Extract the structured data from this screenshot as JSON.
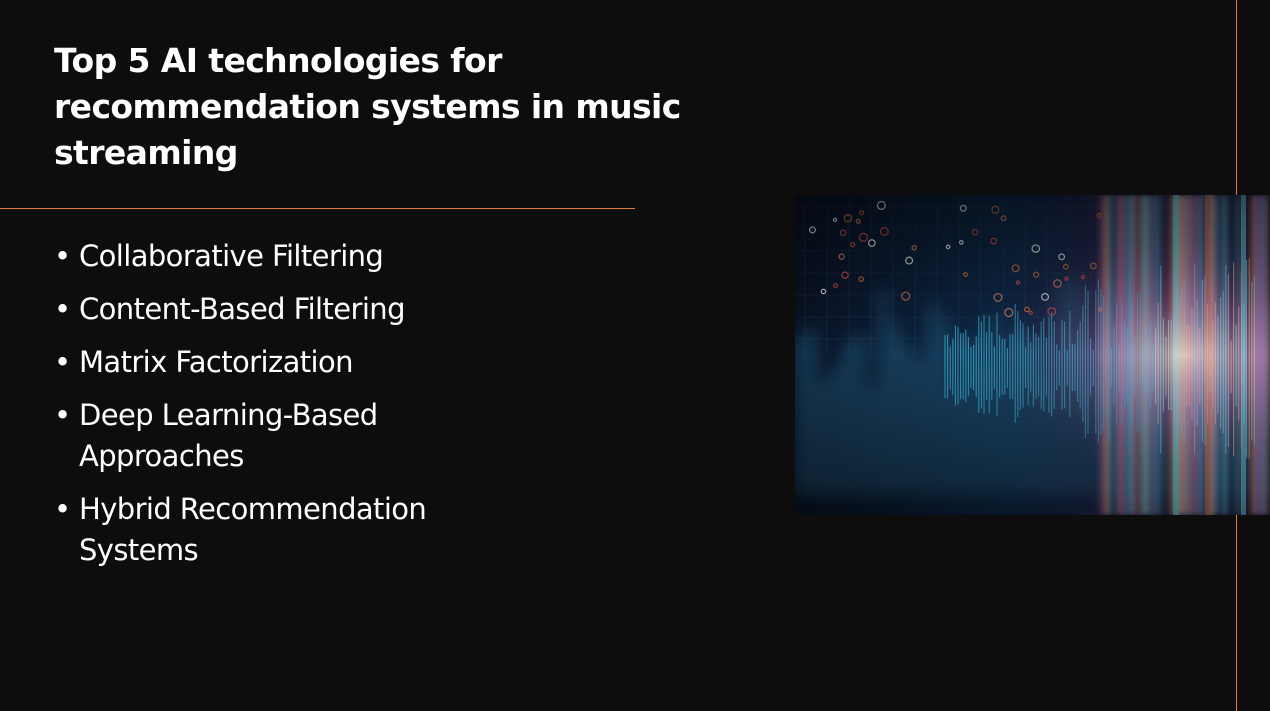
{
  "slide": {
    "title": "Top 5 AI technologies for recommendation systems in music streaming",
    "bullets": [
      "Collaborative Filtering",
      "Content-Based Filtering",
      "Matrix Factorization",
      "Deep Learning-Based Approaches",
      "Hybrid Recommendation Systems"
    ]
  },
  "colors": {
    "background": "#0d0d0d",
    "accent": "#e07b39",
    "text": "#ffffff"
  }
}
